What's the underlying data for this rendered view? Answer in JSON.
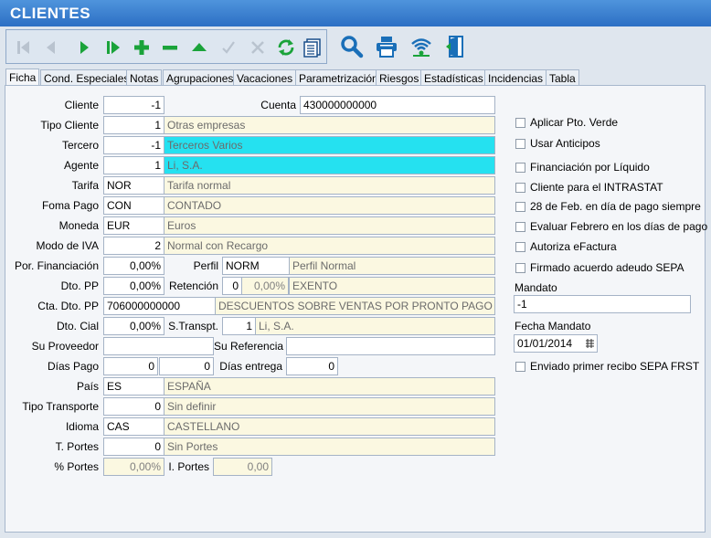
{
  "window": {
    "title": "CLIENTES"
  },
  "toolbar": {
    "buttons": [
      {
        "name": "first-record-icon"
      },
      {
        "name": "previous-record-icon"
      },
      {
        "name": "next-record-icon"
      },
      {
        "name": "last-record-icon"
      },
      {
        "name": "add-record-icon"
      },
      {
        "name": "delete-record-icon"
      },
      {
        "name": "edit-record-icon"
      },
      {
        "name": "confirm-icon"
      },
      {
        "name": "cancel-icon"
      },
      {
        "name": "refresh-icon"
      },
      {
        "name": "list-view-icon"
      }
    ],
    "secondary": [
      {
        "name": "search-icon"
      },
      {
        "name": "print-icon"
      },
      {
        "name": "signal-icon"
      },
      {
        "name": "exit-door-icon"
      }
    ]
  },
  "tabs": [
    {
      "label": "Ficha",
      "active": true
    },
    {
      "label": "Cond. Especiales"
    },
    {
      "label": "Notas"
    },
    {
      "label": "Agrupaciones"
    },
    {
      "label": "Vacaciones"
    },
    {
      "label": "Parametrización"
    },
    {
      "label": "Riesgos"
    },
    {
      "label": "Estadísticas"
    },
    {
      "label": "Incidencias"
    },
    {
      "label": "Tabla"
    }
  ],
  "form": {
    "cliente": {
      "label": "Cliente",
      "value": "-1"
    },
    "cuenta": {
      "label": "Cuenta",
      "value": "430000000000"
    },
    "tipo_cliente": {
      "label": "Tipo Cliente",
      "value": "1",
      "desc": "Otras empresas"
    },
    "tercero": {
      "label": "Tercero",
      "value": "-1",
      "desc": "Terceros Varios"
    },
    "agente": {
      "label": "Agente",
      "value": "1",
      "desc": "Li, S.A."
    },
    "tarifa": {
      "label": "Tarifa",
      "value": "NOR",
      "desc": "Tarifa normal"
    },
    "forma_pago": {
      "label": "Foma Pago",
      "value": "CON",
      "desc": "CONTADO"
    },
    "moneda": {
      "label": "Moneda",
      "value": "EUR",
      "desc": "Euros"
    },
    "modo_iva": {
      "label": "Modo de IVA",
      "value": "2",
      "desc": "Normal con Recargo"
    },
    "por_financiacion": {
      "label": "Por. Financiación",
      "value": "0,00%"
    },
    "perfil": {
      "label": "Perfil",
      "value": "NORM",
      "desc": "Perfil Normal"
    },
    "dto_pp": {
      "label": "Dto. PP",
      "value": "0,00%"
    },
    "retencion": {
      "label": "Retención",
      "value": "0",
      "pct": "0,00%",
      "desc": "EXENTO"
    },
    "cta_dto_pp": {
      "label": "Cta. Dto. PP",
      "value": "706000000000",
      "desc": "DESCUENTOS SOBRE VENTAS POR PRONTO PAGO DE MI"
    },
    "dto_cial": {
      "label": "Dto. Cial",
      "value": "0,00%"
    },
    "s_transpt": {
      "label": "S.Transpt.",
      "value": "1",
      "desc": "Li, S.A."
    },
    "su_proveedor": {
      "label": "Su Proveedor",
      "value": ""
    },
    "su_referencia": {
      "label": "Su Referencia",
      "value": ""
    },
    "dias_pago": {
      "label": "Días Pago",
      "value1": "0",
      "value2": "0"
    },
    "dias_entrega": {
      "label": "Días entrega",
      "value": "0"
    },
    "pais": {
      "label": "País",
      "value": "ES",
      "desc": "ESPAÑA"
    },
    "tipo_transporte": {
      "label": "Tipo Transporte",
      "value": "0",
      "desc": "Sin definir"
    },
    "idioma": {
      "label": "Idioma",
      "value": "CAS",
      "desc": "CASTELLANO"
    },
    "t_portes": {
      "label": "T. Portes",
      "value": "0",
      "desc": "Sin Portes"
    },
    "pct_portes": {
      "label": "% Portes",
      "value": "0,00%"
    },
    "i_portes": {
      "label": "I. Portes",
      "value": "0,00"
    }
  },
  "options": {
    "aplicar_pto_verde": {
      "label": "Aplicar Pto. Verde",
      "checked": false
    },
    "usar_anticipos": {
      "label": "Usar Anticipos",
      "checked": false
    },
    "financiacion_liquido": {
      "label": "Financiación por Líquido",
      "checked": false
    },
    "cliente_intrastat": {
      "label": "Cliente para el INTRASTAT",
      "checked": false
    },
    "feb28": {
      "label": "28 de Feb. en día de pago siempre",
      "checked": false
    },
    "evaluar_febrero": {
      "label": "Evaluar Febrero en los días de pago",
      "checked": false
    },
    "autoriza_efactura": {
      "label": "Autoriza eFactura",
      "checked": false
    },
    "firmado_sepa": {
      "label": "Firmado acuerdo adeudo SEPA",
      "checked": false
    },
    "mandato": {
      "label": "Mandato",
      "value": "-1"
    },
    "fecha_mandato": {
      "label": "Fecha Mandato",
      "value": "01/01/2014"
    },
    "enviado_sepa": {
      "label": "Enviado primer recibo SEPA FRST",
      "checked": false
    }
  },
  "colors": {
    "title_bar": "#3a80d2",
    "highlight_field": "#25e1f0",
    "description_field": "#fbf8e1",
    "green_icon": "#1aa33a",
    "blue_icon": "#1a6fb8"
  }
}
